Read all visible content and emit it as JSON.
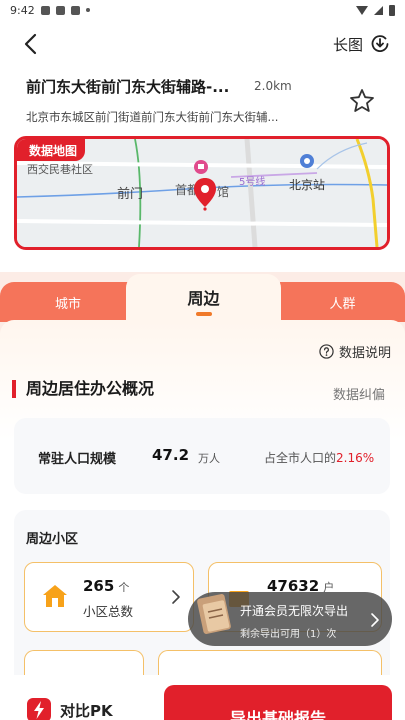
{
  "status_bar": {
    "time": "9:42"
  },
  "nav": {
    "long_image_label": "长图"
  },
  "poi": {
    "title": "前门东大街前门东大街辅路-...",
    "distance": "2.0km",
    "address": "北京市东城区前门街道前门东大街前门东大街辅..."
  },
  "map": {
    "badge": "数据地图",
    "labels": {
      "west_community": "西交民巷社区",
      "qianmen": "前门",
      "museum": "首都",
      "museum_tail": "馆",
      "station": "北京站",
      "line5": "5号线"
    }
  },
  "tabs": [
    {
      "label": "城市"
    },
    {
      "label": "周边"
    },
    {
      "label": "人群"
    }
  ],
  "data_explain": "数据说明",
  "section": {
    "title": "周边居住办公概况",
    "correction": "数据纠偏"
  },
  "population": {
    "label": "常驻人口规模",
    "value": "47.2",
    "unit": "万人",
    "share_prefix": "占全市人口的",
    "share_pct": "2.16%"
  },
  "communities": {
    "title": "周边小区",
    "stats": [
      {
        "value": "265",
        "unit": "个",
        "label": "小区总数"
      },
      {
        "value": "47632",
        "unit": "户",
        "label": ""
      }
    ]
  },
  "vip_toast": {
    "title": "开通会员无限次导出",
    "subtitle": "剩余导出可用（1）次"
  },
  "bottom": {
    "pk_label": "对比PK",
    "export_label": "导出基础报告"
  },
  "colors": {
    "brand_red": "#e1202b",
    "tab_orange": "#f5745a",
    "accent_yellow": "#f4c068"
  }
}
